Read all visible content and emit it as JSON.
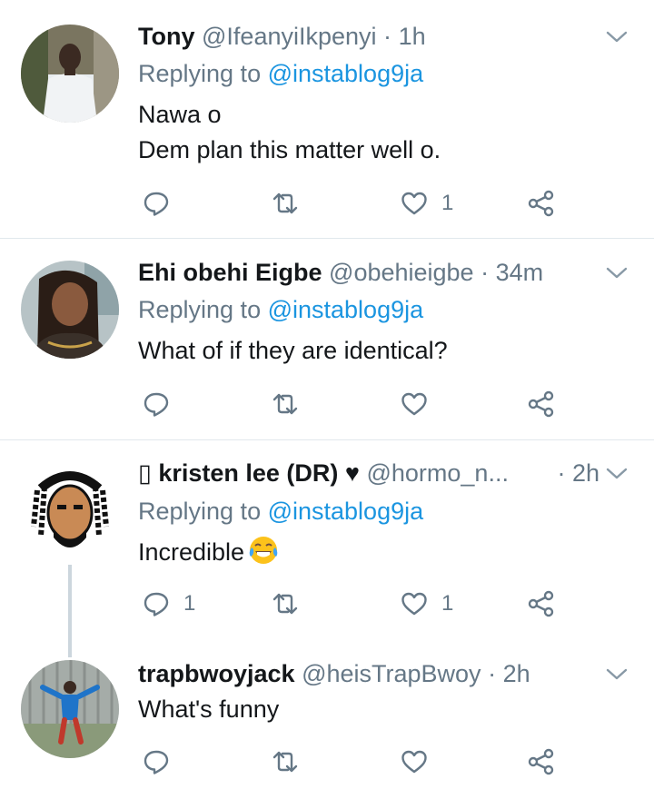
{
  "tweets": [
    {
      "name": "Tony",
      "handle": "@IfeanyiIkpenyi",
      "time": "1h",
      "replying_label": "Replying to ",
      "replying_to": "@instablog9ja",
      "body_lines": [
        "Nawa o",
        "Dem plan this matter well o."
      ],
      "reply_count": "",
      "retweet_count": "",
      "like_count": "1"
    },
    {
      "name": "Ehi obehi Eigbe",
      "handle": "@obehieigbe",
      "time": "34m",
      "replying_label": "Replying to ",
      "replying_to": "@instablog9ja",
      "body_lines": [
        "What of if they are identical?"
      ],
      "reply_count": "",
      "retweet_count": "",
      "like_count": ""
    },
    {
      "name": "▯ kristen lee (DR) ♥",
      "handle": "@hormo_n...",
      "time": "2h",
      "replying_label": "Replying to ",
      "replying_to": "@instablog9ja",
      "body_lines": [
        "Incredible"
      ],
      "reply_count": "1",
      "retweet_count": "",
      "like_count": "1"
    },
    {
      "name": "trapbwoyjack",
      "handle": "@heisTrapBwoy",
      "time": "2h",
      "body_lines": [
        "What's funny"
      ],
      "reply_count": "",
      "retweet_count": "",
      "like_count": ""
    }
  ],
  "separator": "·",
  "icons": {
    "reply": "reply-icon",
    "retweet": "retweet-icon",
    "like": "heart-icon",
    "share": "share-icon",
    "caret": "chevron-down-icon",
    "emoji": "tears-of-joy-emoji"
  },
  "colors": {
    "text": "#14171a",
    "muted": "#657786",
    "link": "#1b95e0",
    "divider": "#e1e8ed"
  }
}
